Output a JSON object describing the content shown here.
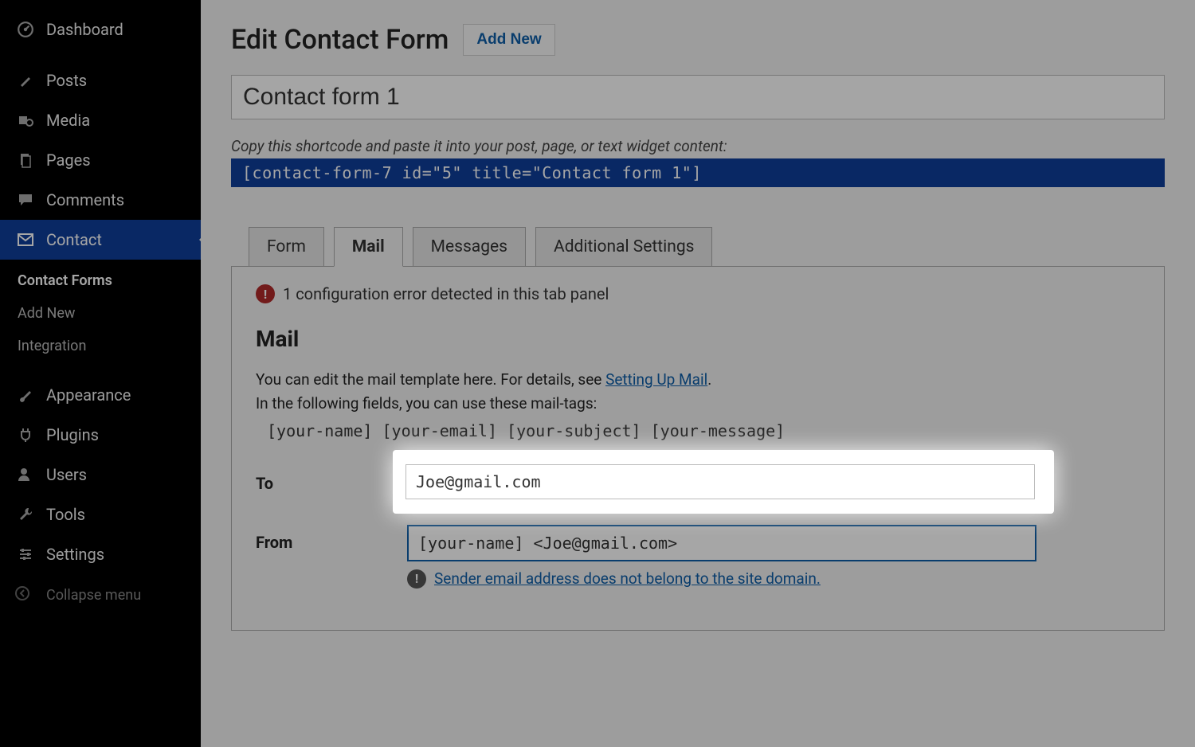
{
  "sidebar": {
    "dashboard": "Dashboard",
    "posts": "Posts",
    "media": "Media",
    "pages": "Pages",
    "comments": "Comments",
    "contact": "Contact",
    "contact_sub": {
      "forms": "Contact Forms",
      "addnew": "Add New",
      "integration": "Integration"
    },
    "appearance": "Appearance",
    "plugins": "Plugins",
    "users": "Users",
    "tools": "Tools",
    "settings": "Settings",
    "collapse": "Collapse menu"
  },
  "header": {
    "title": "Edit Contact Form",
    "add_new": "Add New"
  },
  "form_title": "Contact form 1",
  "shortcode_hint": "Copy this shortcode and paste it into your post, page, or text widget content:",
  "shortcode": "[contact-form-7 id=\"5\" title=\"Contact form 1\"]",
  "tabs": {
    "form": "Form",
    "mail": "Mail",
    "messages": "Messages",
    "additional": "Additional Settings"
  },
  "panel": {
    "config_error": "1 configuration error detected in this tab panel",
    "heading": "Mail",
    "desc1_prefix": "You can edit the mail template here. For details, see ",
    "desc1_link": "Setting Up Mail",
    "desc1_suffix": ".",
    "desc2": "In the following fields, you can use these mail-tags:",
    "mailtags": "[your-name] [your-email] [your-subject] [your-message]",
    "to_label": "To",
    "to_value": "Joe@gmail.com",
    "from_label": "From",
    "from_value": "[your-name] <Joe@gmail.com>",
    "from_warning": "Sender email address does not belong to the site domain."
  }
}
